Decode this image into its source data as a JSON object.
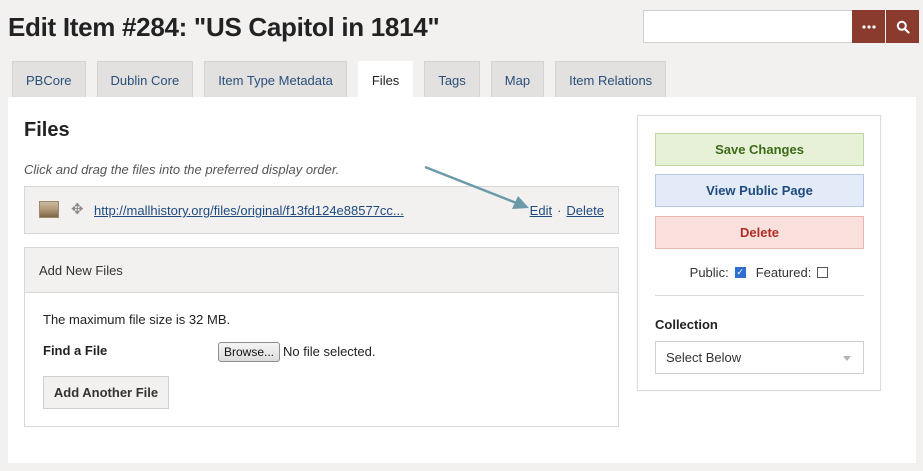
{
  "page": {
    "title": "Edit Item #284: \"US Capitol in 1814\""
  },
  "search": {
    "placeholder": "",
    "more_icon": "more-icon",
    "search_icon": "search-icon",
    "accent_color": "#8a3b2e"
  },
  "tabs": [
    {
      "label": "PBCore",
      "active": false
    },
    {
      "label": "Dublin Core",
      "active": false
    },
    {
      "label": "Item Type Metadata",
      "active": false
    },
    {
      "label": "Files",
      "active": true
    },
    {
      "label": "Tags",
      "active": false
    },
    {
      "label": "Map",
      "active": false
    },
    {
      "label": "Item Relations",
      "active": false
    }
  ],
  "files_section": {
    "heading": "Files",
    "instructions": "Click and drag the files into the preferred display order.",
    "file": {
      "link_text": "http://mallhistory.org/files/original/f13fd124e88577cc...",
      "edit_label": "Edit",
      "separator": "·",
      "delete_label": "Delete"
    }
  },
  "add_files": {
    "header": "Add New Files",
    "max_size_text": "The maximum file size is 32 MB.",
    "find_label": "Find a File",
    "browse_label": "Browse...",
    "no_file_text": "No file selected.",
    "add_another_label": "Add Another File"
  },
  "sidebar": {
    "save_label": "Save Changes",
    "view_label": "View Public Page",
    "delete_label": "Delete",
    "public_label": "Public:",
    "public_checked": true,
    "featured_label": "Featured:",
    "featured_checked": false,
    "collection_label": "Collection",
    "collection_selected": "Select Below"
  },
  "colors": {
    "save": "#3e6b17",
    "view": "#1f4a80",
    "delete": "#b02e24",
    "annotation_arrow": "#6b9aa8"
  }
}
